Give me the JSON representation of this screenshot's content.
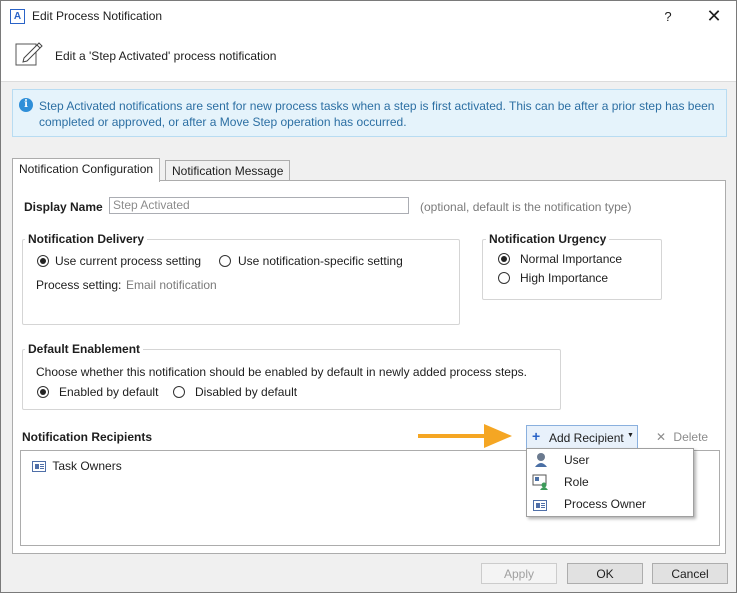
{
  "window": {
    "title": "Edit Process Notification",
    "app_icon_letter": "A",
    "help_label": "?",
    "close_label": "✕"
  },
  "header": {
    "text": "Edit a 'Step Activated' process notification"
  },
  "info_banner": {
    "text": "Step Activated notifications are sent for new process tasks when a step is first activated. This can be after a prior step has been completed or approved, or after a Move Step operation has occurred."
  },
  "tabs": [
    {
      "label": "Notification Configuration",
      "active": true
    },
    {
      "label": "Notification Message",
      "active": false
    }
  ],
  "display_name": {
    "label": "Display Name",
    "value": "Step Activated",
    "hint": "(optional, default is the notification type)"
  },
  "delivery": {
    "legend": "Notification Delivery",
    "option_current": "Use current process setting",
    "option_specific": "Use notification-specific setting",
    "selected": "current",
    "process_setting_label": "Process setting:",
    "process_setting_value": "Email notification"
  },
  "urgency": {
    "legend": "Notification Urgency",
    "option_normal": "Normal Importance",
    "option_high": "High Importance",
    "selected": "normal"
  },
  "enablement": {
    "legend": "Default Enablement",
    "description": "Choose whether this notification should be enabled by default in newly added process steps.",
    "option_enabled": "Enabled by default",
    "option_disabled": "Disabled by default",
    "selected": "enabled"
  },
  "recipients": {
    "label": "Notification Recipients",
    "add_label": "Add Recipient",
    "delete_label": "Delete",
    "items": [
      {
        "label": "Task Owners",
        "icon": "id-card-icon"
      }
    ],
    "menu": [
      {
        "label": "User",
        "icon": "user-icon"
      },
      {
        "label": "Role",
        "icon": "role-icon"
      },
      {
        "label": "Process Owner",
        "icon": "id-card-icon"
      }
    ]
  },
  "footer": {
    "apply_label": "Apply",
    "ok_label": "OK",
    "cancel_label": "Cancel"
  },
  "colors": {
    "accent": "#2f8fd8",
    "arrow": "#f5a623",
    "info_text": "#2c6fa3",
    "info_bg": "#e5f3fb"
  }
}
